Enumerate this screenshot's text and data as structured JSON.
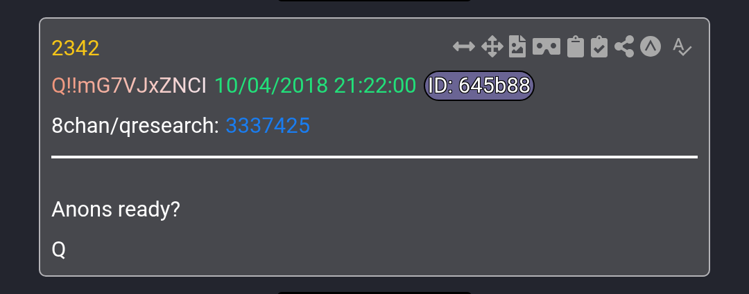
{
  "post": {
    "number": "2342",
    "author": "Q!!mG7VJxZNCI",
    "timestamp": "10/04/2018 21:22:00",
    "id_badge": "ID: 645b88",
    "board": "8chan/qresearch:",
    "thread_link": "3337425",
    "toolbar": [
      {
        "kind": "widen"
      },
      {
        "kind": "move"
      },
      {
        "kind": "image"
      },
      {
        "kind": "cardboard"
      },
      {
        "kind": "clipboard"
      },
      {
        "kind": "clipboard-check"
      },
      {
        "kind": "share"
      },
      {
        "kind": "circle-a"
      },
      {
        "kind": "spellcheck"
      }
    ],
    "body": [
      "Anons ready?",
      "Q"
    ]
  }
}
